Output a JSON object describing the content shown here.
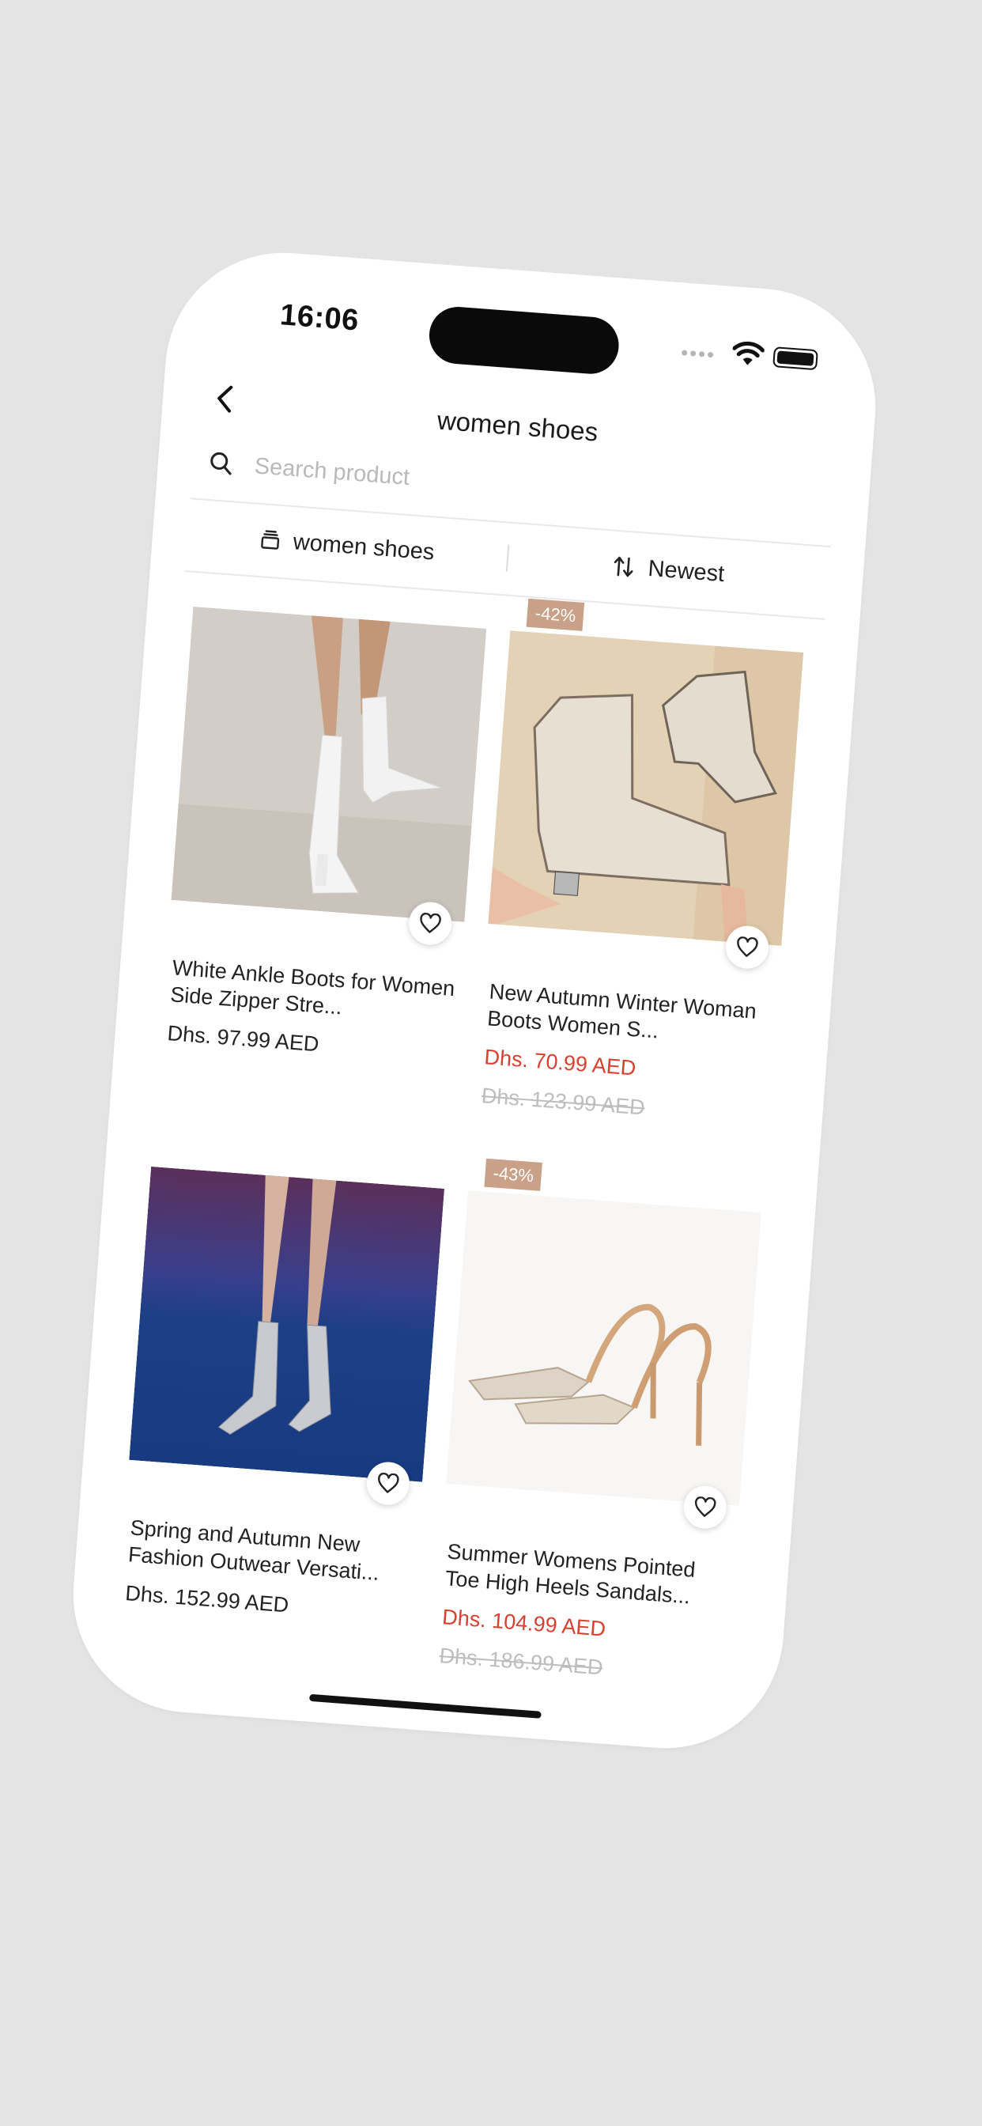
{
  "status_bar": {
    "time": "16:06"
  },
  "header": {
    "title": "women shoes"
  },
  "search": {
    "placeholder": "Search product"
  },
  "filters": {
    "category_label": "women shoes",
    "sort_label": "Newest"
  },
  "products": [
    {
      "name": "White Ankle Boots for Women  Side Zipper Stre...",
      "price": "Dhs. 97.99 AED"
    },
    {
      "discount": "-42%",
      "name": "New Autumn Winter Woman Boots Women S...",
      "price": "Dhs. 70.99 AED",
      "original_price": "Dhs. 123.99 AED"
    },
    {
      "name": "Spring and Autumn New Fashion Outwear Versati...",
      "price": "Dhs. 152.99 AED"
    },
    {
      "discount": "-43%",
      "name": "Summer Womens Pointed Toe High Heels Sandals...",
      "price": "Dhs. 104.99 AED",
      "original_price": "Dhs. 186.99 AED"
    }
  ],
  "icons": [
    "back-chevron-icon",
    "search-icon",
    "category-stack-icon",
    "sort-arrows-icon",
    "heart-icon",
    "wifi-icon",
    "battery-icon"
  ],
  "colors": {
    "sale_price": "#d8402f",
    "discount_badge": "#c9a088",
    "original_price": "#bdbdbd"
  }
}
